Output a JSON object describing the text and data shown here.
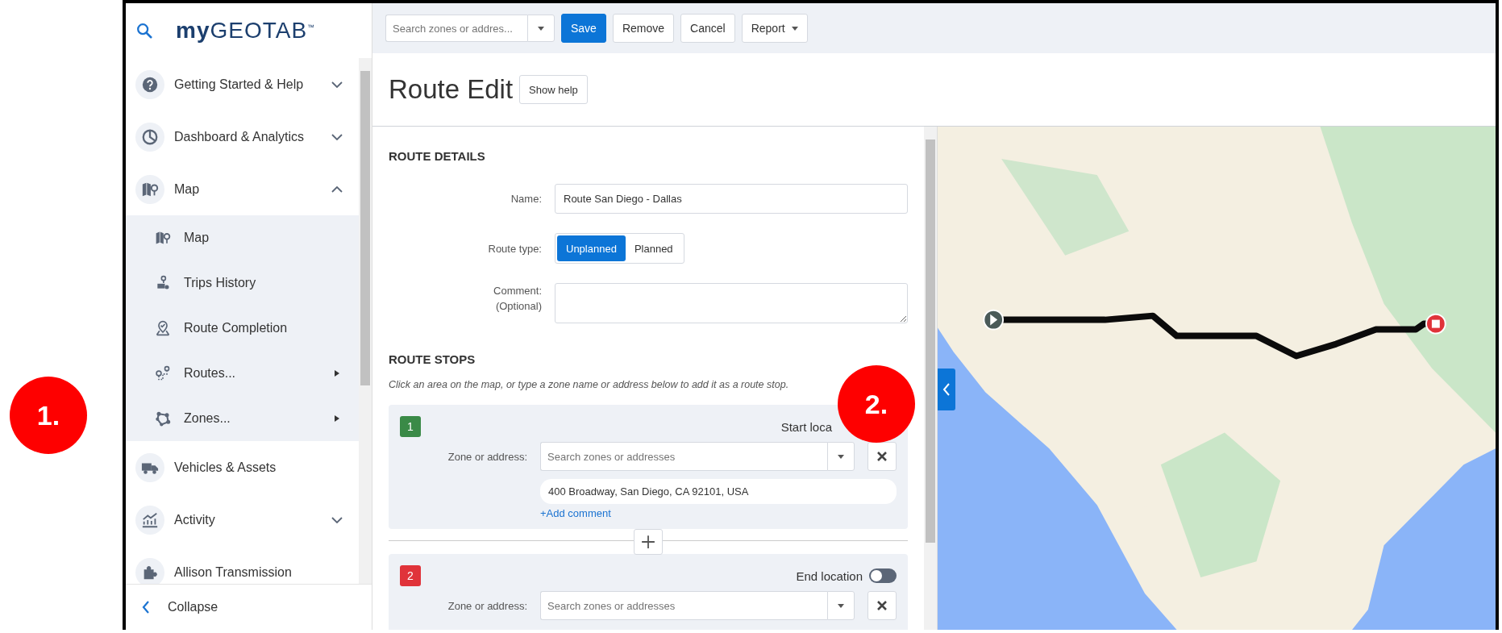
{
  "annotations": [
    {
      "label": "1."
    },
    {
      "label": "2."
    }
  ],
  "sidebar": {
    "logo": "**my**GEOTAB$^{™}$",
    "items": [
      {
        "label": "Getting Started & Help",
        "expandable": true,
        "expanded": false
      },
      {
        "label": "Dashboard & Analytics",
        "expandable": true,
        "expanded": false
      },
      {
        "label": "Map",
        "expandable": true,
        "expanded": true,
        "children": [
          {
            "label": "Map",
            "submenu": false
          },
          {
            "label": "Trips History",
            "submenu": false
          },
          {
            "label": "Route Completion",
            "submenu": false
          },
          {
            "label": "Routes...",
            "submenu": true
          },
          {
            "label": "Zones...",
            "submenu": true
          }
        ]
      },
      {
        "label": "Vehicles & Assets",
        "expandable": false,
        "expanded": false
      },
      {
        "label": "Activity",
        "expandable": true,
        "expanded": false
      },
      {
        "label": "Allison Transmission",
        "expandable": false,
        "expanded": false
      }
    ],
    "collapse": "Collapse"
  },
  "toolbar": {
    "search_placeholder": "Search zones or addres...",
    "buttons": [
      {
        "label": "Save",
        "kind": "primary",
        "menu": false
      },
      {
        "label": "Remove",
        "kind": "default",
        "menu": false
      },
      {
        "label": "Cancel",
        "kind": "default",
        "menu": false
      },
      {
        "label": "Report",
        "kind": "default",
        "menu": true
      }
    ]
  },
  "header": {
    "title": "Route Edit",
    "help_button": "Show help"
  },
  "route_details": {
    "heading": "ROUTE DETAILS",
    "name_label": "Name:",
    "name_value": "Route San Diego - Dallas",
    "type_label": "Route type:",
    "type_options": [
      {
        "label": "Unplanned",
        "selected": true
      },
      {
        "label": "Planned",
        "selected": false
      }
    ],
    "comment_label": "Comment:",
    "comment_hint": "(Optional)"
  },
  "route_stops": {
    "heading": "ROUTE STOPS",
    "instructions": "Click an area on the map, or type a zone name or address below to add it as a route stop.",
    "stops": [
      {
        "number": "1",
        "color": "#3a8a47",
        "location_label": "Start loca",
        "zone_label": "Zone or address:",
        "placeholder": "Search zones or addresses",
        "address": "400 Broadway, San Diego, CA 92101, USA",
        "add_comment": "+Add comment"
      },
      {
        "number": "2",
        "color": "#e0333a",
        "location_label": "End location",
        "on": false,
        "zone_label": "Zone or address:",
        "placeholder": "Search zones or addresses"
      }
    ]
  }
}
